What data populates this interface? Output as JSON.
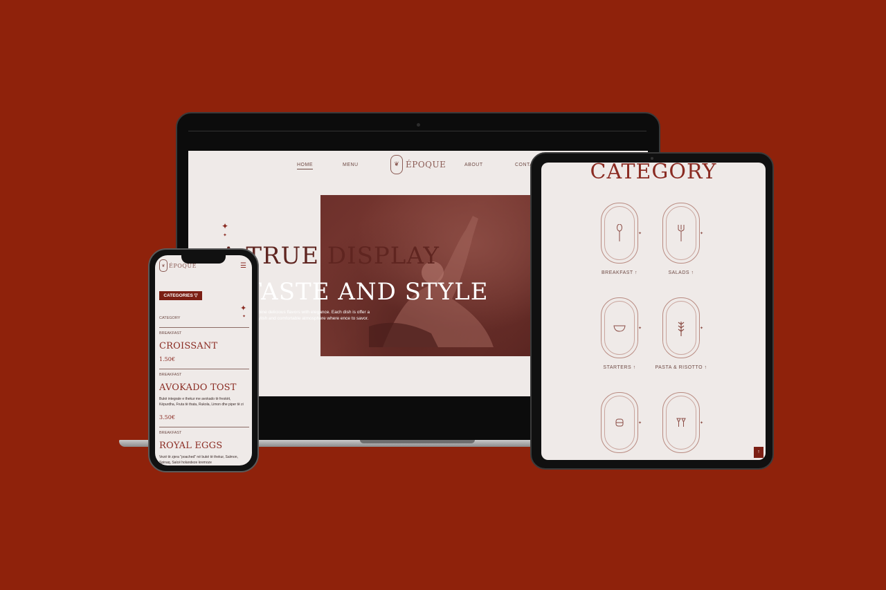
{
  "laptop": {
    "nav": {
      "home": "HOME",
      "menu": "MENU",
      "brand": "ÉPOQUE",
      "about": "ABOUT",
      "contact": "CONTA"
    },
    "hero": {
      "title_line1": "A TRUE DISPLAY",
      "title_line2": "A TASTE AND STYLE",
      "description": "mbine delicious flavors with elegance. Each dish is offer a stylish and comfortable atmosphere where ence to savor."
    }
  },
  "tablet": {
    "title": "CATEGORY",
    "categories": [
      {
        "label": "BREAKFAST",
        "icon": "spoon-icon"
      },
      {
        "label": "SALADS",
        "icon": "fork-icon"
      },
      {
        "label": "STARTERS",
        "icon": "bowl-icon"
      },
      {
        "label": "PASTA & RISOTTO",
        "icon": "wheat-icon"
      },
      {
        "label": "",
        "icon": "burger-icon"
      },
      {
        "label": "",
        "icon": "cocktail-icon"
      }
    ],
    "scroll_top": "↑"
  },
  "phone": {
    "brand": "ÉPOQUE",
    "categories_button": "CATEGORIES ▽",
    "category_label": "CATEGORY",
    "items": [
      {
        "tag": "BREAKFAST",
        "name": "CROISSANT",
        "price": "1.50€",
        "desc": ""
      },
      {
        "tag": "BREAKFAST",
        "name": "AVOKADO TOST",
        "price": "3.50€",
        "desc": "Bukë integrale e thekur me avokado të freskët, Këpurdha, Fruta të thata, Rukola, Limon dhe piper të zi"
      },
      {
        "tag": "BREAKFAST",
        "name": "ROYAL EGGS",
        "price": "",
        "desc": "Vezë të zjera \"poached\" në bukë të thekur, Salmon, Spinaq, Salcë holandeze kremoze"
      }
    ]
  },
  "colors": {
    "background": "#8f220b",
    "accent": "#8a2b22",
    "screen": "#efeae8"
  }
}
